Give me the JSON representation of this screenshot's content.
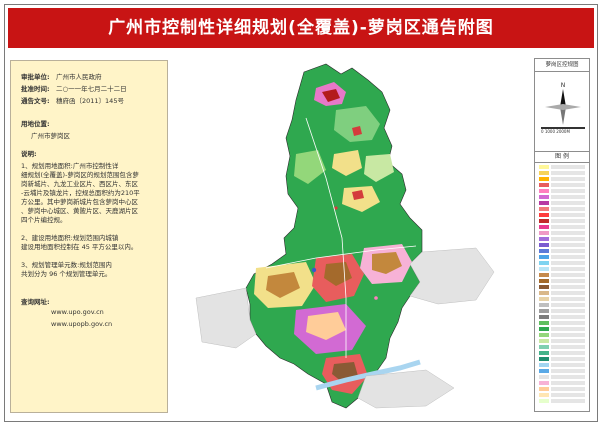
{
  "title": "广州市控制性详细规划(全覆盖)-萝岗区通告附图",
  "left_panel": {
    "approval_unit_label": "审批单位:",
    "approval_unit": "广州市人民政府",
    "approval_time_label": "批准时间:",
    "approval_time": "二○一一年七月二十二日",
    "notice_no_label": "通告文号:",
    "notice_no": "穗府函〔2011〕145号",
    "land_location_label": "用地位置:",
    "land_location": "广州市萝岗区",
    "notes_label": "说明:",
    "note1_lines": [
      "1、规划用地面积:广州市控制性详",
      "细规划(全覆盖)-萝岗区的规划范围包含萝",
      "岗新城片、九龙工业区片、西区片、东区",
      "-云埔片及镇龙片，控规总面积约为210平",
      "方公里。其中萝岗新城片包含萝岗中心区",
      "、萝岗中心城区、黄陂片区、天鹿湖片区",
      "四个片编控规。"
    ],
    "note2_lines": [
      "2、建设用地面积:规划范围内城镇",
      "建设用地面积控制在 45 平方公里以内。"
    ],
    "note3_lines": [
      "3、规划管理单元数:规划范围内",
      "共划分为 96 个规划管理单元。"
    ],
    "website_label": "查询网址:",
    "websites": [
      "www.upo.gov.cn",
      "www.upopb.gov.cn"
    ]
  },
  "right_panel": {
    "header": "萝岗区控规图",
    "compass_letter": "N",
    "scale_text": "0  1000  2000M",
    "legend_title": "图  例"
  },
  "colors": {
    "title_bg": "#c81414",
    "left_bg": "#fff4c8",
    "green_land": "#2fa84f",
    "light_green": "#7fcf7f",
    "residential": "#f2e08a",
    "industrial": "#c3883d",
    "commercial": "#d43c3c",
    "water": "#a9d5f0",
    "admin": "#e778c8"
  },
  "legend_swatches": [
    "#fff799",
    "#f6d35a",
    "#ffb400",
    "#e85d5d",
    "#ff7fbf",
    "#d26ad3",
    "#b63aa3",
    "#f07a7a",
    "#ff3c3c",
    "#c22b2b",
    "#e83b8f",
    "#ef9ac6",
    "#a26edb",
    "#7a5bd0",
    "#5c7ad8",
    "#4ba3e6",
    "#7dd3f0",
    "#b7e4f5",
    "#c58a4c",
    "#a46a2c",
    "#8a5a35",
    "#d9b88a",
    "#e7d2a7",
    "#bfbfbf",
    "#9e9e9e",
    "#7d7d7d",
    "#5fbf5f",
    "#2fa84f",
    "#93d77a",
    "#c8e8a3",
    "#7fcfb0",
    "#43b38a",
    "#1f8e6f",
    "#a2d5f2",
    "#5aa9e6",
    "#e3e3e3",
    "#f7b2d6",
    "#ffcc99",
    "#ffe6b3",
    "#e6ffcc"
  ]
}
